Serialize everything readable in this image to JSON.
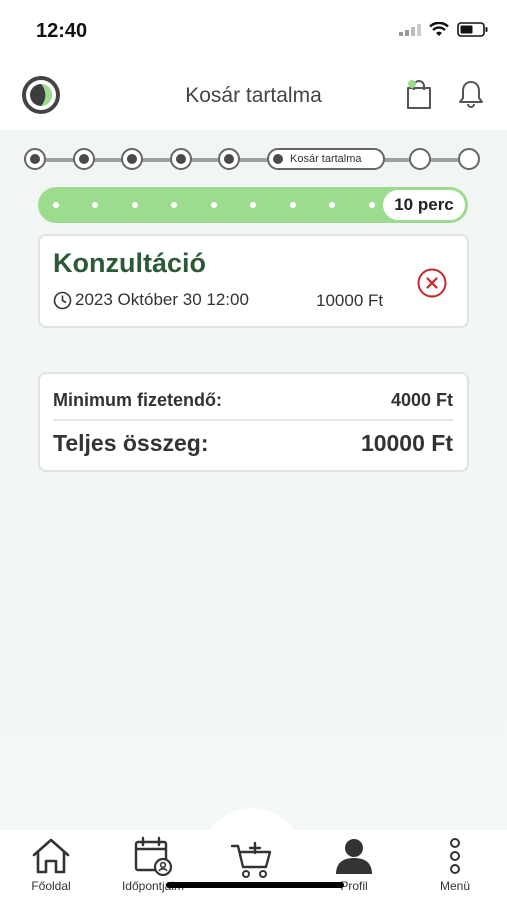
{
  "status_bar": {
    "time": "12:40"
  },
  "header": {
    "title": "Kosár tartalma"
  },
  "stepper": {
    "current_label": "Kosár tartalma"
  },
  "timer": {
    "label": "10 perc"
  },
  "cart_item": {
    "title": "Konzultáció",
    "datetime": "2023 Október 30 12:00",
    "price": "10000 Ft"
  },
  "summary": {
    "min_label": "Minimum fizetendő:",
    "min_value": "4000 Ft",
    "total_label": "Teljes összeg:",
    "total_value": "10000 Ft"
  },
  "nav": {
    "home": "Főoldal",
    "appointments": "Időpontjaim",
    "profile": "Profil",
    "menu": "Menü"
  },
  "colors": {
    "brand_green": "#2d5a36",
    "timer_green": "#9ddc8f",
    "remove_red": "#c62828"
  },
  "icons": [
    "clock-icon",
    "remove-icon",
    "cart-icon",
    "bell-icon",
    "home-icon",
    "calendar-user-icon",
    "cart-plus-icon",
    "profile-icon",
    "more-vertical-icon"
  ]
}
